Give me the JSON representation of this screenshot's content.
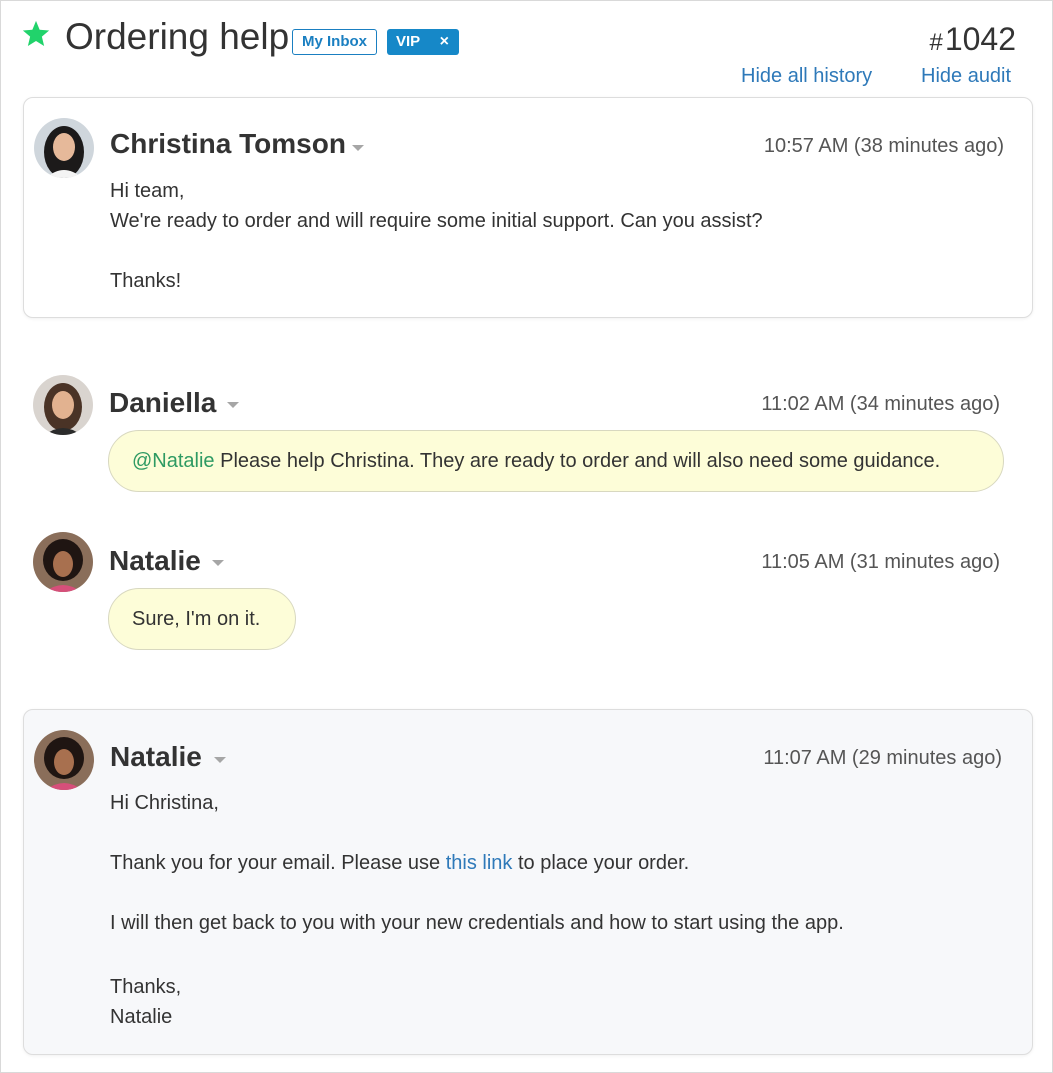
{
  "header": {
    "title": "Ordering help",
    "tags": {
      "inbox": "My Inbox",
      "vip": "VIP",
      "vip_remove": "×"
    },
    "ticket_hash": "#",
    "ticket_number": "1042",
    "hide_history": "Hide all history",
    "hide_audit": "Hide audit"
  },
  "messages": [
    {
      "author": "Christina Tomson",
      "time": "10:57 AM (38 minutes ago)",
      "lines": [
        "Hi team,",
        "We're ready to order and will require some initial support. Can you assist?",
        "",
        "Thanks!"
      ]
    },
    {
      "author": "Daniella",
      "time": "11:02 AM (34 minutes ago)",
      "mention": "@Natalie",
      "text": " Please help Christina. They are ready to order and will also need some guidance."
    },
    {
      "author": "Natalie",
      "time": "11:05 AM (31 minutes ago)",
      "text": "Sure, I'm on  it."
    },
    {
      "author": "Natalie",
      "time": "11:07 AM (29 minutes ago)",
      "greeting": "Hi Christina,",
      "line2_before": "Thank you for your email. Please use ",
      "line2_link": "this link",
      "line2_after": " to place your order.",
      "line3": "I will then get back to you with your new credentials and how to start using the app.",
      "sign1": "Thanks,",
      "sign2": "Natalie"
    }
  ],
  "colors": {
    "star": "#21d36b",
    "link": "#2e79b9",
    "vip_bg": "#1688c8",
    "mention": "#2e9a63",
    "bubble_bg": "#fdfdd8"
  },
  "icons": {
    "star": "star-icon",
    "caret": "caret-down-icon",
    "close": "close-icon"
  }
}
